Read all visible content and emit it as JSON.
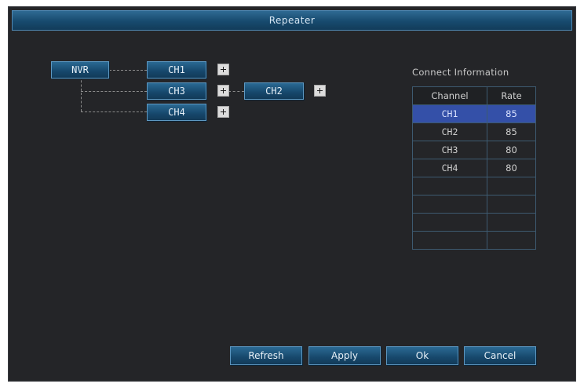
{
  "window": {
    "title": "Repeater"
  },
  "topology": {
    "root": {
      "label": "NVR"
    },
    "nodes": [
      {
        "id": "ch1",
        "label": "CH1"
      },
      {
        "id": "ch3",
        "label": "CH3"
      },
      {
        "id": "ch2",
        "label": "CH2"
      },
      {
        "id": "ch4",
        "label": "CH4"
      }
    ],
    "add_icon": "plus-square-icon"
  },
  "connect_info": {
    "title": "Connect Information",
    "columns": [
      "Channel",
      "Rate"
    ],
    "rows": [
      {
        "channel": "CH1",
        "rate": "85"
      },
      {
        "channel": "CH2",
        "rate": "85"
      },
      {
        "channel": "CH3",
        "rate": "80"
      },
      {
        "channel": "CH4",
        "rate": "80"
      }
    ],
    "selected_row": 0,
    "selected_color": "#3450a8"
  },
  "buttons": {
    "refresh": "Refresh",
    "apply": "Apply",
    "ok": "Ok",
    "cancel": "Cancel"
  },
  "colors": {
    "background": "#242528",
    "accent": "#17486c"
  }
}
